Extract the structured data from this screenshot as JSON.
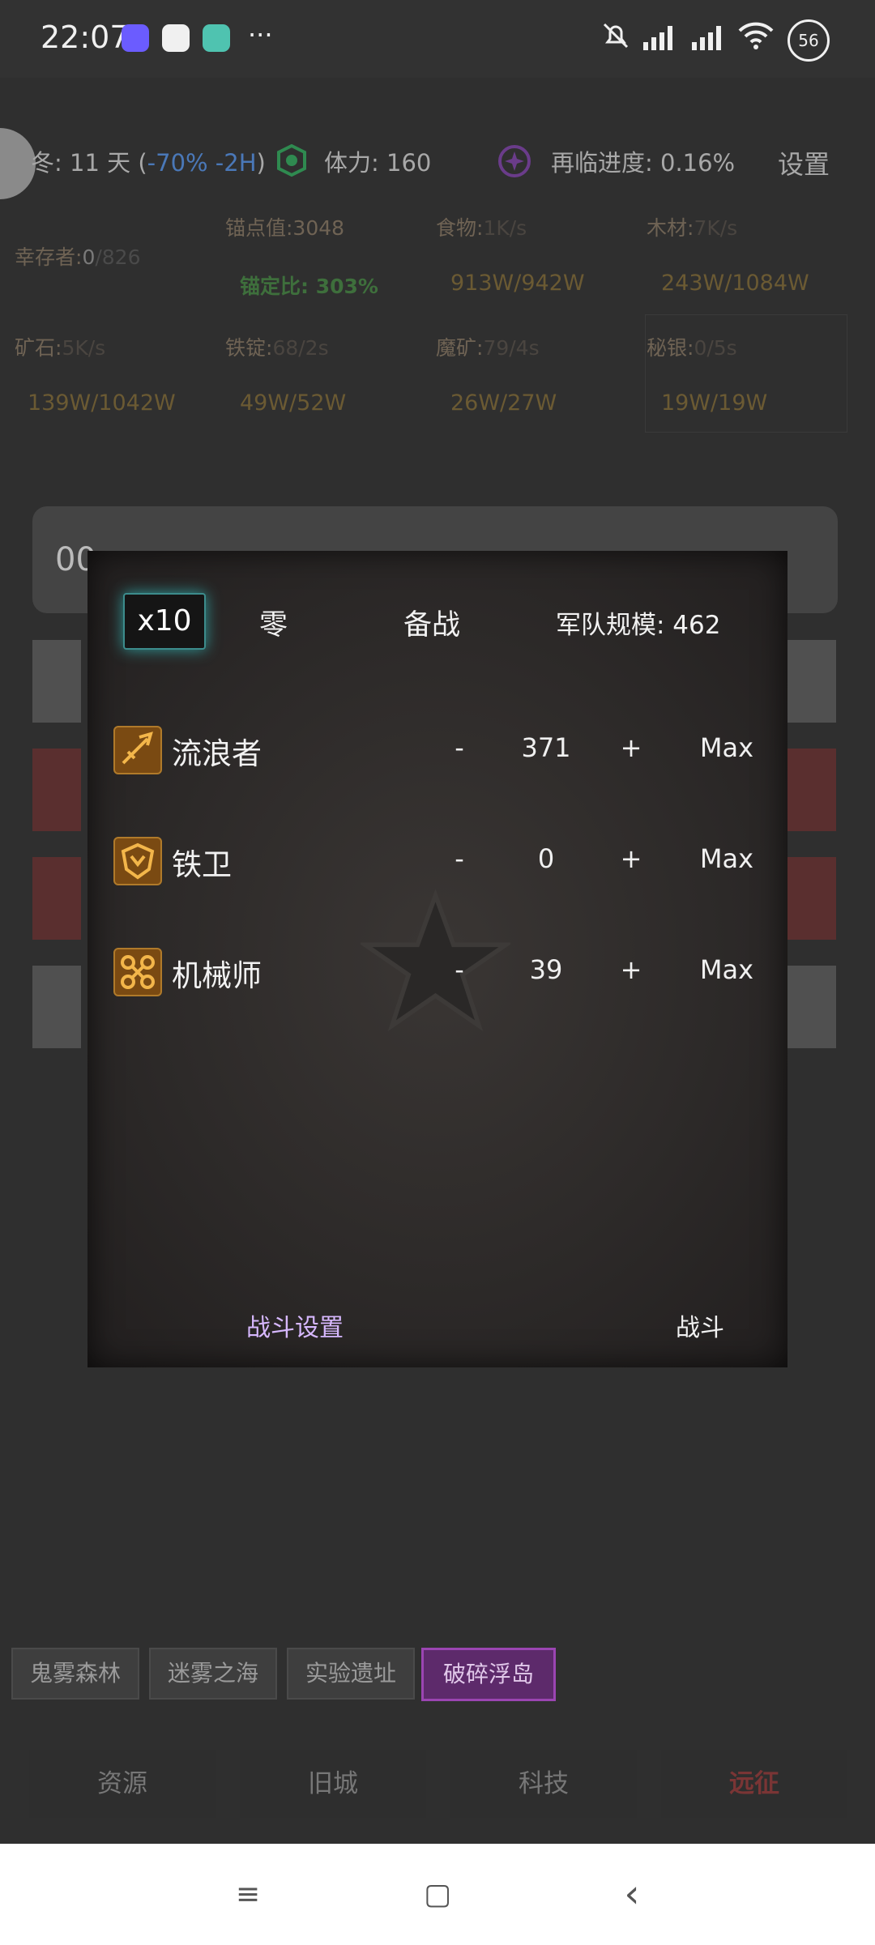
{
  "status_bar": {
    "time": "22:07",
    "more": "···",
    "battery": "56"
  },
  "header": {
    "season": "冬: 11 天 (",
    "season_effect": "-70% -2H",
    "season_close": ")",
    "stamina": "体力: 160",
    "progress": "再临进度: 0.16%",
    "settings": "设置"
  },
  "resources": {
    "survivors_label": "幸存者:",
    "survivors_current": "0",
    "survivors_total": "/826",
    "anchor": "锚点值:3048",
    "anchor_ratio": "锚定比: 303%",
    "food_label": "食物:",
    "food_rate": "1K/s",
    "food_amount": "913W/942W",
    "wood_label": "木材:",
    "wood_rate": "7K/s",
    "wood_amount": "243W/1084W",
    "ore_label": "矿石:",
    "ore_rate": "5K/s",
    "ore_amount": "139W/1042W",
    "ingot_label": "铁锭:",
    "ingot_rate": "68/2s",
    "ingot_amount": "49W/52W",
    "magic_label": "魔矿:",
    "magic_rate": "79/4s",
    "magic_amount": "26W/27W",
    "silver_label": "秘银:",
    "silver_rate": "0/5s",
    "silver_amount": "19W/19W"
  },
  "background_bar": {
    "text": "00"
  },
  "modal": {
    "multiplier": "x10",
    "zero": "零",
    "prepare": "备战",
    "army_size": "军队规模: 462",
    "units": [
      {
        "name": "流浪者",
        "minus": "-",
        "value": "371",
        "plus": "+",
        "max": "Max",
        "icon": "wanderer-icon"
      },
      {
        "name": "铁卫",
        "minus": "-",
        "value": "0",
        "plus": "+",
        "max": "Max",
        "icon": "iron-guard-icon"
      },
      {
        "name": "机械师",
        "minus": "-",
        "value": "39",
        "plus": "+",
        "max": "Max",
        "icon": "mechanic-icon"
      }
    ],
    "battle_settings": "战斗设置",
    "battle": "战斗",
    "colors": {
      "battle_settings": "#d7b8ff",
      "battle": "#f2f2f2"
    }
  },
  "regions": [
    "鬼雾森林",
    "迷雾之海",
    "实验遗址",
    "破碎浮岛"
  ],
  "active_region": "破碎浮岛",
  "bottom_nav": [
    "资源",
    "旧城",
    "科技",
    "远征"
  ],
  "active_tab": "远征",
  "system_nav": {
    "menu": "≡",
    "home": "▢",
    "back": "‹"
  }
}
